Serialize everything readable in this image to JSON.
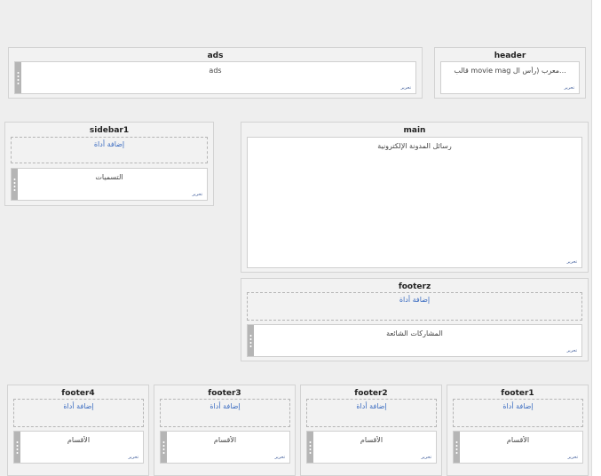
{
  "sections": {
    "ads": {
      "title": "ads",
      "widget_title": "ads",
      "edit_label": "تحرير"
    },
    "header": {
      "title": "header",
      "widget_title": "قالب movie mag معرب (رأس ال...",
      "edit_label": "تحرير"
    },
    "sidebar1": {
      "title": "sidebar1",
      "add_label": "إضافة أداة",
      "widget_title": "التسميات",
      "edit_label": "تحرير"
    },
    "main": {
      "title": "main",
      "widget_title": "رسائل المدونة الإلكترونية",
      "edit_label": "تحرير"
    },
    "footerz": {
      "title": "footerz",
      "add_label": "إضافة أداة",
      "widget_title": "المشاركات الشائعة",
      "edit_label": "تحرير"
    },
    "footer4": {
      "title": "footer4",
      "add_label": "إضافة أداة",
      "widget_title": "الأقسام",
      "edit_label": "تحرير"
    },
    "footer3": {
      "title": "footer3",
      "add_label": "إضافة أداة",
      "widget_title": "الأقسام",
      "edit_label": "تحرير"
    },
    "footer2": {
      "title": "footer2",
      "add_label": "إضافة أداة",
      "widget_title": "الأقسام",
      "edit_label": "تحرير"
    },
    "footer1": {
      "title": "footer1",
      "add_label": "إضافة أداة",
      "widget_title": "الأقسام",
      "edit_label": "تحرير"
    }
  }
}
